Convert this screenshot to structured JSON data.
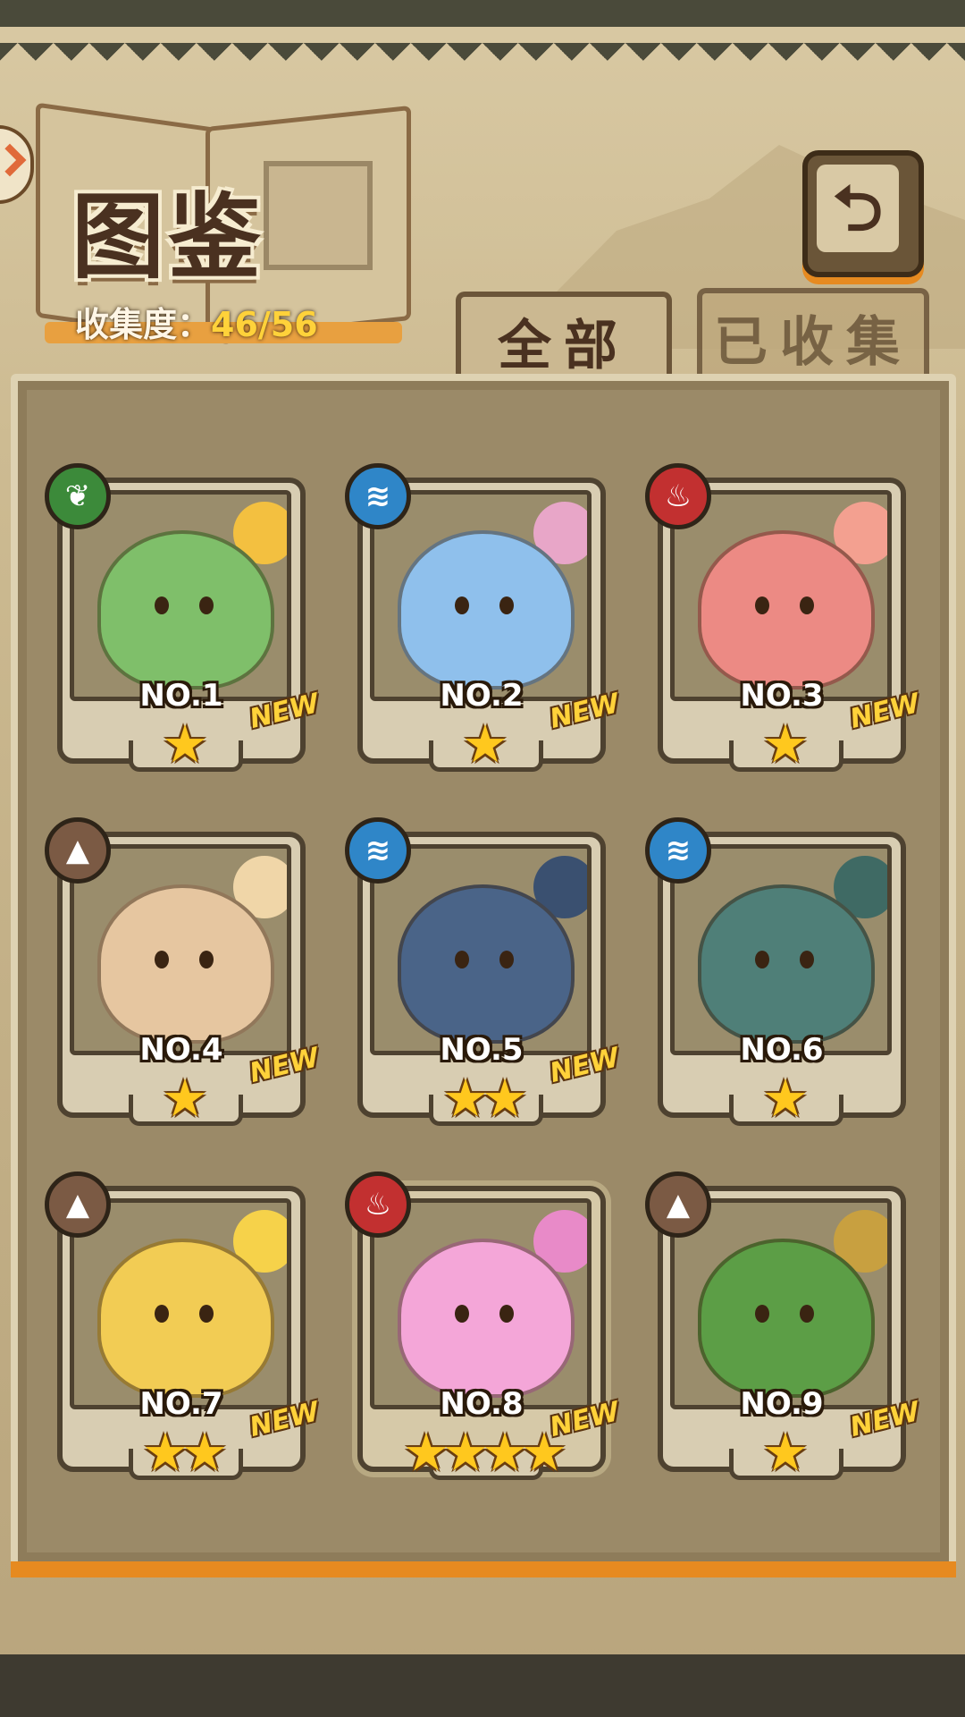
{
  "header": {
    "title": "图鉴",
    "collection_label": "收集度：",
    "collection_value": "46/56"
  },
  "back_button": {
    "glyph": "⮌"
  },
  "tabs": [
    {
      "label": "全部",
      "active": true
    },
    {
      "label": "已收集",
      "active": false
    }
  ],
  "colors": {
    "plant": "#3c8a3a",
    "water": "#2f86c8",
    "fire": "#c23030",
    "earth": "#7b5a44",
    "accent": "#e68a20",
    "star": "#ffc81e"
  },
  "cards": [
    {
      "number": "NO.1",
      "element": "plant",
      "stars": 1,
      "stars_text": "★",
      "new": "NEW",
      "body_color": "#7fbf6a",
      "deco_color": "#f3c040"
    },
    {
      "number": "NO.2",
      "element": "water",
      "stars": 1,
      "stars_text": "★",
      "new": "NEW",
      "body_color": "#8fc0ec",
      "deco_color": "#e8a6c8"
    },
    {
      "number": "NO.3",
      "element": "fire",
      "stars": 1,
      "stars_text": "★",
      "new": "NEW",
      "body_color": "#ec8a84",
      "deco_color": "#f3a090"
    },
    {
      "number": "NO.4",
      "element": "earth",
      "stars": 1,
      "stars_text": "★",
      "new": "NEW",
      "body_color": "#e6c6a0",
      "deco_color": "#f0d6a8"
    },
    {
      "number": "NO.5",
      "element": "water",
      "stars": 2,
      "stars_text": "★★",
      "new": "NEW",
      "body_color": "#4a6488",
      "deco_color": "#3a5070"
    },
    {
      "number": "NO.6",
      "element": "water",
      "stars": 1,
      "stars_text": "★",
      "new": "",
      "body_color": "#4f7f78",
      "deco_color": "#3f6a64"
    },
    {
      "number": "NO.7",
      "element": "earth",
      "stars": 2,
      "stars_text": "★★",
      "new": "NEW",
      "body_color": "#f2cc54",
      "deco_color": "#f6d24a"
    },
    {
      "number": "NO.8",
      "element": "fire",
      "stars": 4,
      "stars_text": "★★★★",
      "new": "NEW",
      "body_color": "#f4a6d8",
      "deco_color": "#e88ac8"
    },
    {
      "number": "NO.9",
      "element": "earth",
      "stars": 1,
      "stars_text": "★",
      "new": "NEW",
      "body_color": "#5c9e46",
      "deco_color": "#c8a040"
    }
  ]
}
